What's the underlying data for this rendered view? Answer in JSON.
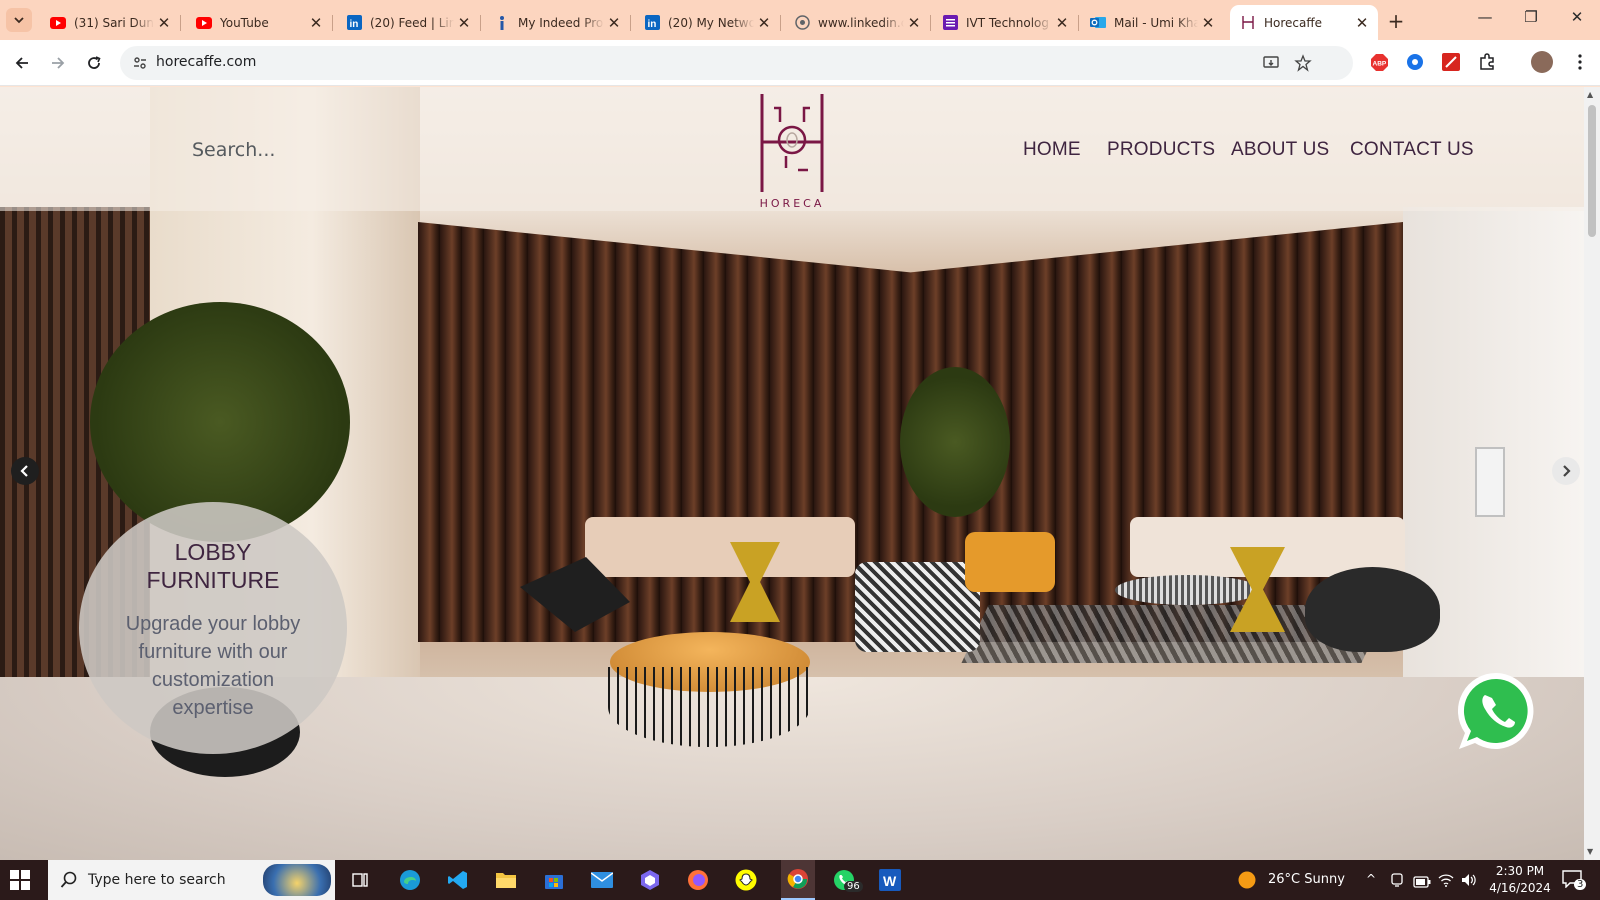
{
  "browser": {
    "tabs": [
      {
        "title": "(31) Sari Duny",
        "icon": "youtube-icon",
        "color": "#ff0000"
      },
      {
        "title": "YouTube",
        "icon": "youtube-icon",
        "color": "#ff0000"
      },
      {
        "title": "(20) Feed | Lin",
        "icon": "linkedin-icon",
        "color": "#0a66c2"
      },
      {
        "title": "My Indeed Pro",
        "icon": "indeed-icon",
        "color": "#2557a7"
      },
      {
        "title": "(20) My Netwo",
        "icon": "linkedin-icon",
        "color": "#0a66c2"
      },
      {
        "title": "www.linkedin.c",
        "icon": "globe-icon",
        "color": "#5f6368"
      },
      {
        "title": "IVT Technolog",
        "icon": "forms-icon",
        "color": "#6a1bb1"
      },
      {
        "title": "Mail - Umi Kha",
        "icon": "outlook-icon",
        "color": "#0f6cbd"
      },
      {
        "title": "Horecaffe",
        "icon": "horeca-favicon",
        "color": "#7a1745"
      }
    ],
    "url": "horecaffe.com"
  },
  "site": {
    "search_placeholder": "Search...",
    "logo_text": "HORECA",
    "nav": [
      "HOME",
      "PRODUCTS",
      "ABOUT US",
      "CONTACT US"
    ],
    "slide": {
      "title": "LOBBY FURNITURE",
      "text": "Upgrade your lobby furniture with our customization expertise"
    },
    "brand_color": "#7a1745"
  },
  "taskbar": {
    "search_text": "Type here to search",
    "whatsapp_badge": "96",
    "weather": "26°C  Sunny",
    "time": "2:30 PM",
    "date": "4/16/2024",
    "notifications": "3"
  }
}
